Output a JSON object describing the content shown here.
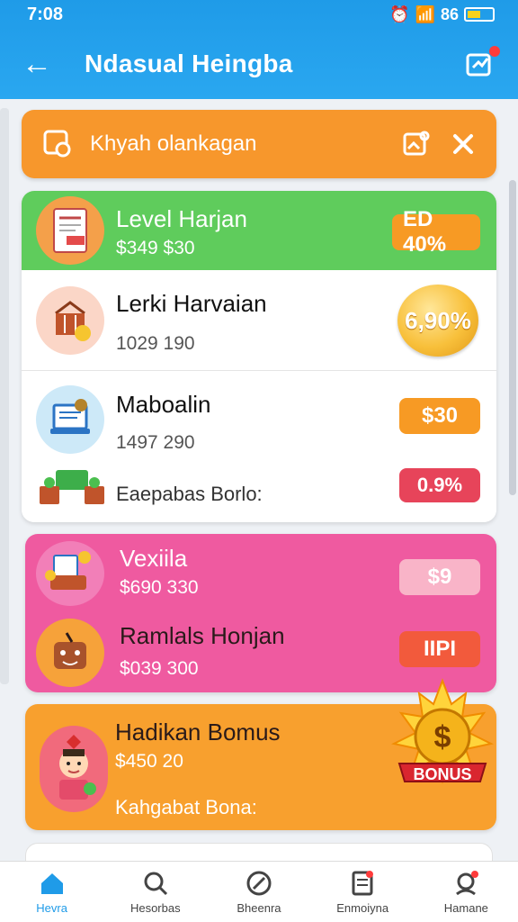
{
  "status": {
    "time": "7:08",
    "right": "86"
  },
  "header": {
    "title": "Ndasual Heingba"
  },
  "banner": {
    "text": "Khyah olankagan"
  },
  "group1": {
    "rows": [
      {
        "title": "Level Harjan",
        "sub": "$349 $30",
        "tag": "ED 40%"
      },
      {
        "title": "Lerki Harvaian",
        "sub": "1029 190",
        "tag": "6,90%"
      },
      {
        "title": "Maboalin",
        "sub": "1497 290",
        "tag": "$30"
      }
    ],
    "extra": {
      "label": "Eaepabas Borlo:",
      "tag": "0.9%"
    }
  },
  "pink": {
    "rows": [
      {
        "title": "Vexiila",
        "sub": "$690 330",
        "tag": "$9"
      },
      {
        "title": "Ramlals Honjan",
        "sub": "$039 300",
        "tag": "IIPI"
      }
    ]
  },
  "bonus": {
    "title": "Hadikan Bomus",
    "sub": "$450 20",
    "extra": "Kahgabat Bona:",
    "emblem": "BONUS"
  },
  "nav": {
    "items": [
      {
        "label": "Hevra"
      },
      {
        "label": "Hesorbas"
      },
      {
        "label": "Bheenra"
      },
      {
        "label": "Enmoiyna"
      },
      {
        "label": "Hamane"
      }
    ]
  },
  "colors": {
    "primary": "#1f9be8",
    "orange": "#f7972c",
    "green": "#5fcc5c",
    "pink": "#ef5aa0"
  }
}
